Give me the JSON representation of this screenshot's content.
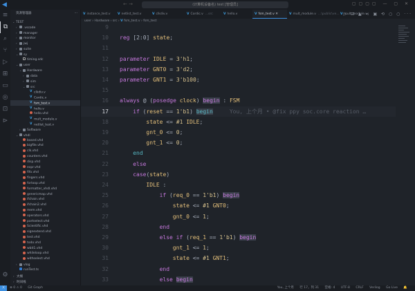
{
  "titlebar": {
    "search_text": "(计算机设备名) test [管理员]"
  },
  "sidebar": {
    "title": "资源管理器",
    "more": "···",
    "items": [
      {
        "label": "TEST",
        "depth": 0,
        "type": "root",
        "open": true
      },
      {
        "label": ".vscode",
        "depth": 1,
        "type": "folder"
      },
      {
        "label": "manager",
        "depth": 1,
        "type": "folder"
      },
      {
        "label": "monitor",
        "depth": 1,
        "type": "folder"
      },
      {
        "label": "jwj",
        "depth": 1,
        "type": "folder"
      },
      {
        "label": "suite",
        "depth": 1,
        "type": "folder"
      },
      {
        "label": "sy",
        "depth": 1,
        "type": "folder",
        "open": true
      },
      {
        "label": "timing.sdc",
        "depth": 2,
        "type": "sdc"
      },
      {
        "label": "user",
        "depth": 1,
        "type": "folder",
        "open": true
      },
      {
        "label": "Hardware",
        "depth": 2,
        "type": "folder",
        "open": true
      },
      {
        "label": "data",
        "depth": 3,
        "type": "folder"
      },
      {
        "label": "sim",
        "depth": 3,
        "type": "folder"
      },
      {
        "label": "src",
        "depth": 3,
        "type": "folder",
        "open": true
      },
      {
        "label": "clkdiv.v",
        "depth": 4,
        "type": "v"
      },
      {
        "label": "Cordic.v",
        "depth": 4,
        "type": "v"
      },
      {
        "label": "fsm_test.v",
        "depth": 4,
        "type": "v",
        "selected": true
      },
      {
        "label": "hello.v",
        "depth": 4,
        "type": "v"
      },
      {
        "label": "hello.vhd",
        "depth": 4,
        "type": "vhd"
      },
      {
        "label": "mult_module.v",
        "depth": 4,
        "type": "v"
      },
      {
        "label": "netlist_test.v",
        "depth": 4,
        "type": "v"
      },
      {
        "label": "Software",
        "depth": 2,
        "type": "folder"
      },
      {
        "label": "vhdl",
        "depth": 1,
        "type": "folder",
        "open": true
      },
      {
        "label": "based.vhd",
        "depth": 2,
        "type": "vhd"
      },
      {
        "label": "bigfile.vhd",
        "depth": 2,
        "type": "vhd"
      },
      {
        "label": "clk.vhd",
        "depth": 2,
        "type": "vhd"
      },
      {
        "label": "counters.vhd",
        "depth": 2,
        "type": "vhd"
      },
      {
        "label": "disp.vhd",
        "depth": 2,
        "type": "vhd"
      },
      {
        "label": "expr.vhd",
        "depth": 2,
        "type": "vhd"
      },
      {
        "label": "fifo.vhd",
        "depth": 2,
        "type": "vhd"
      },
      {
        "label": "fingers.vhd",
        "depth": 2,
        "type": "vhd"
      },
      {
        "label": "forloop.vhd",
        "depth": 2,
        "type": "vhd"
      },
      {
        "label": "formatter_vhdl.vhd",
        "depth": 2,
        "type": "vhd"
      },
      {
        "label": "genericmap.vhd",
        "depth": 2,
        "type": "vhd"
      },
      {
        "label": "ifchain.vhd",
        "depth": 2,
        "type": "vhd"
      },
      {
        "label": "ifchain2.vhd",
        "depth": 2,
        "type": "vhd"
      },
      {
        "label": "mem.vhd",
        "depth": 2,
        "type": "vhd"
      },
      {
        "label": "operators.vhd",
        "depth": 2,
        "type": "vhd"
      },
      {
        "label": "partselect.vhd",
        "depth": 2,
        "type": "vhd"
      },
      {
        "label": "Scientific.vhd",
        "depth": 2,
        "type": "vhd"
      },
      {
        "label": "signextend.vhd",
        "depth": 2,
        "type": "vhd"
      },
      {
        "label": "test.vhd",
        "depth": 2,
        "type": "vhd"
      },
      {
        "label": "todo.vhd",
        "depth": 2,
        "type": "vhd"
      },
      {
        "label": "wbit1.vhd",
        "depth": 2,
        "type": "vhd"
      },
      {
        "label": "whileloop.vhd",
        "depth": 2,
        "type": "vhd"
      },
      {
        "label": "withselect.vhd",
        "depth": 2,
        "type": "vhd"
      },
      {
        "label": "vlog",
        "depth": 1,
        "type": "folder"
      },
      {
        "label": "runTest.ts",
        "depth": 1,
        "type": "ts"
      }
    ],
    "panels": [
      {
        "label": "大纲"
      },
      {
        "label": "时间线"
      }
    ]
  },
  "tabs": [
    {
      "label": "instance_test.v",
      "sub": ""
    },
    {
      "label": "netlist_test.v",
      "sub": ""
    },
    {
      "label": "clkdiv.v",
      "sub": ""
    },
    {
      "label": "Cordic.v",
      "sub": "...src"
    },
    {
      "label": "hello.v",
      "sub": ""
    },
    {
      "label": "fsm_test.v",
      "sub": "",
      "active": true
    },
    {
      "label": "mult_module.v",
      "sub": "...\\public\\ve..."
    },
    {
      "label": "mult_module.v",
      "sub": ""
    }
  ],
  "breadcrumb": [
    "user",
    "Hardware",
    "src",
    "fsm_test.v",
    "fsm_test"
  ],
  "editor": {
    "current_line": 17,
    "blame": "You, 上个月 • @fix ppy soc.core reaction …",
    "lines": [
      {
        "n": 9,
        "ind": 0,
        "t": []
      },
      {
        "n": 10,
        "ind": 0,
        "t": [
          [
            "k",
            "reg "
          ],
          [
            "o",
            "[2:0] "
          ],
          [
            "i",
            "state"
          ],
          [
            "o",
            ";"
          ]
        ]
      },
      {
        "n": 11,
        "ind": 0,
        "t": []
      },
      {
        "n": 12,
        "ind": 0,
        "t": [
          [
            "k",
            "parameter "
          ],
          [
            "i",
            "IDLE "
          ],
          [
            "o",
            "= "
          ],
          [
            "n",
            "3'h1"
          ],
          [
            "o",
            ";"
          ]
        ]
      },
      {
        "n": 13,
        "ind": 0,
        "t": [
          [
            "k",
            "parameter "
          ],
          [
            "i",
            "GNT0 "
          ],
          [
            "o",
            "= "
          ],
          [
            "n",
            "3'd2"
          ],
          [
            "o",
            ";"
          ]
        ]
      },
      {
        "n": 14,
        "ind": 0,
        "t": [
          [
            "k",
            "parameter "
          ],
          [
            "i",
            "GNT1 "
          ],
          [
            "o",
            "= "
          ],
          [
            "n",
            "3'b100"
          ],
          [
            "o",
            ";"
          ]
        ]
      },
      {
        "n": 15,
        "ind": 0,
        "t": []
      },
      {
        "n": 16,
        "ind": 0,
        "t": [
          [
            "k",
            "always "
          ],
          [
            "o",
            "@ ("
          ],
          [
            "k",
            "posedge "
          ],
          [
            "i",
            "clock"
          ],
          [
            "o",
            ") "
          ],
          [
            "khl",
            "begin"
          ],
          [
            "o",
            " : "
          ],
          [
            "i",
            "FSM"
          ]
        ]
      },
      {
        "n": 17,
        "ind": 1,
        "t": [
          [
            "k",
            "if "
          ],
          [
            "o",
            "("
          ],
          [
            "i",
            "reset "
          ],
          [
            "o",
            "== "
          ],
          [
            "n",
            "1'b1"
          ],
          [
            "o",
            ") "
          ],
          [
            "thl",
            "begin"
          ]
        ]
      },
      {
        "n": 18,
        "ind": 2,
        "t": [
          [
            "i",
            "state "
          ],
          [
            "o",
            "<= "
          ],
          [
            "n",
            "#1 "
          ],
          [
            "i",
            "IDLE"
          ],
          [
            "o",
            ";"
          ]
        ]
      },
      {
        "n": 19,
        "ind": 2,
        "t": [
          [
            "i",
            "gnt_0 "
          ],
          [
            "o",
            "<= "
          ],
          [
            "n",
            "0"
          ],
          [
            "o",
            ";"
          ]
        ]
      },
      {
        "n": 20,
        "ind": 2,
        "t": [
          [
            "i",
            "gnt_1 "
          ],
          [
            "o",
            "<= "
          ],
          [
            "n",
            "0"
          ],
          [
            "o",
            ";"
          ]
        ]
      },
      {
        "n": 21,
        "ind": 1,
        "t": [
          [
            "t",
            "end"
          ]
        ]
      },
      {
        "n": 22,
        "ind": 1,
        "t": [
          [
            "k",
            "else"
          ]
        ]
      },
      {
        "n": 23,
        "ind": 1,
        "t": [
          [
            "k",
            "case"
          ],
          [
            "o",
            "("
          ],
          [
            "i",
            "state"
          ],
          [
            "o",
            ")"
          ]
        ]
      },
      {
        "n": 24,
        "ind": 2,
        "t": [
          [
            "i",
            "IDLE "
          ],
          [
            "o",
            ":"
          ]
        ]
      },
      {
        "n": 25,
        "ind": 3,
        "t": [
          [
            "k",
            "if "
          ],
          [
            "o",
            "("
          ],
          [
            "i",
            "req_0 "
          ],
          [
            "o",
            "== "
          ],
          [
            "n",
            "1'b1"
          ],
          [
            "o",
            ") "
          ],
          [
            "khl",
            "begin"
          ]
        ]
      },
      {
        "n": 26,
        "ind": 4,
        "t": [
          [
            "i",
            "state "
          ],
          [
            "o",
            "<= "
          ],
          [
            "n",
            "#1 "
          ],
          [
            "i",
            "GNT0"
          ],
          [
            "o",
            ";"
          ]
        ]
      },
      {
        "n": 27,
        "ind": 4,
        "t": [
          [
            "i",
            "gnt_0 "
          ],
          [
            "o",
            "<= "
          ],
          [
            "n",
            "1"
          ],
          [
            "o",
            ";"
          ]
        ]
      },
      {
        "n": 28,
        "ind": 3,
        "t": [
          [
            "k",
            "end"
          ]
        ]
      },
      {
        "n": 29,
        "ind": 3,
        "t": [
          [
            "k",
            "else if "
          ],
          [
            "o",
            "("
          ],
          [
            "i",
            "req_1 "
          ],
          [
            "o",
            "== "
          ],
          [
            "n",
            "1'b1"
          ],
          [
            "o",
            ") "
          ],
          [
            "khl",
            "begin"
          ]
        ]
      },
      {
        "n": 30,
        "ind": 4,
        "t": [
          [
            "i",
            "gnt_1 "
          ],
          [
            "o",
            "<= "
          ],
          [
            "n",
            "1"
          ],
          [
            "o",
            ";"
          ]
        ]
      },
      {
        "n": 31,
        "ind": 4,
        "t": [
          [
            "i",
            "state "
          ],
          [
            "o",
            "<= "
          ],
          [
            "n",
            "#1 "
          ],
          [
            "i",
            "GNT1"
          ],
          [
            "o",
            ";"
          ]
        ]
      },
      {
        "n": 32,
        "ind": 3,
        "t": [
          [
            "k",
            "end"
          ]
        ]
      },
      {
        "n": 33,
        "ind": 3,
        "t": [
          [
            "k",
            "else "
          ],
          [
            "khl",
            "begin"
          ]
        ]
      }
    ]
  },
  "statusbar": {
    "errors": "⊗ 0 ⚠ 0",
    "graph": "Git Graph",
    "blame": "You, 上个月",
    "position": "行 17，列 31",
    "spaces": "空格: 4",
    "encoding": "UTF-8",
    "eol": "CRLF",
    "language": "Verilog",
    "golive": "Go Live"
  }
}
